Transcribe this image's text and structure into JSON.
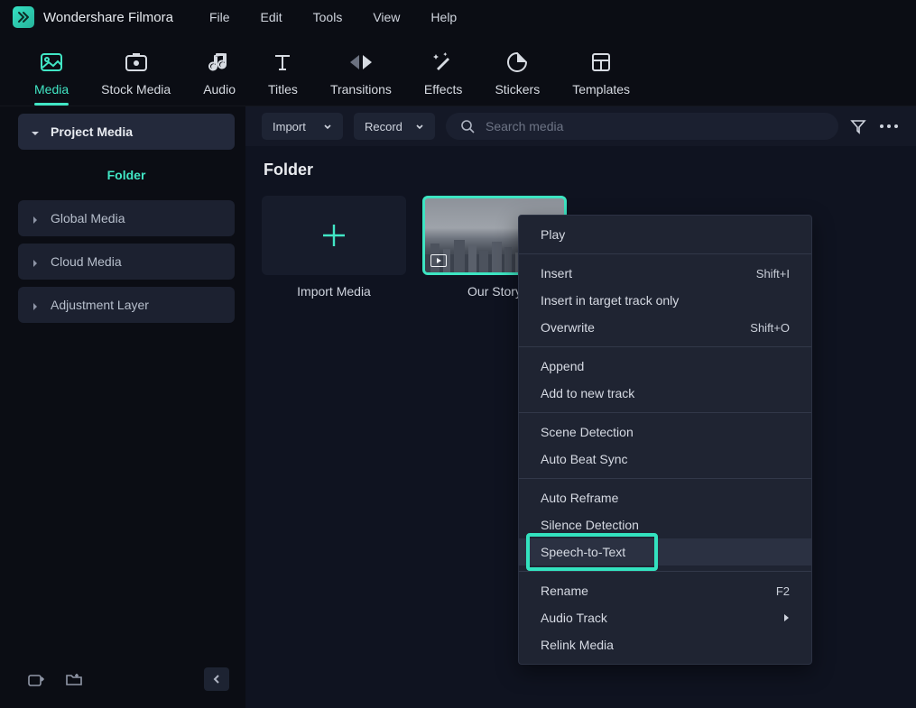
{
  "app": {
    "title": "Wondershare Filmora"
  },
  "menubar": [
    "File",
    "Edit",
    "Tools",
    "View",
    "Help"
  ],
  "tabs": [
    {
      "label": "Media",
      "icon": "media",
      "active": true
    },
    {
      "label": "Stock Media",
      "icon": "stock"
    },
    {
      "label": "Audio",
      "icon": "audio"
    },
    {
      "label": "Titles",
      "icon": "titles"
    },
    {
      "label": "Transitions",
      "icon": "transitions"
    },
    {
      "label": "Effects",
      "icon": "effects"
    },
    {
      "label": "Stickers",
      "icon": "stickers"
    },
    {
      "label": "Templates",
      "icon": "templates"
    }
  ],
  "sidebar": {
    "project": "Project Media",
    "folder": "Folder",
    "items": [
      "Global Media",
      "Cloud Media",
      "Adjustment Layer"
    ]
  },
  "toolbar": {
    "import": "Import",
    "record": "Record",
    "search_placeholder": "Search media"
  },
  "content": {
    "folder_title": "Folder",
    "import_card": "Import Media",
    "clip_card": "Our Story"
  },
  "context_menu": {
    "groups": [
      [
        {
          "label": "Play"
        }
      ],
      [
        {
          "label": "Insert",
          "shortcut": "Shift+I"
        },
        {
          "label": "Insert in target track only"
        },
        {
          "label": "Overwrite",
          "shortcut": "Shift+O"
        }
      ],
      [
        {
          "label": "Append"
        },
        {
          "label": "Add to new track"
        }
      ],
      [
        {
          "label": "Scene Detection"
        },
        {
          "label": "Auto Beat Sync"
        }
      ],
      [
        {
          "label": "Auto Reframe"
        },
        {
          "label": "Silence Detection"
        },
        {
          "label": "Speech-to-Text",
          "highlighted": true,
          "hover": true
        }
      ],
      [
        {
          "label": "Rename",
          "shortcut": "F2"
        },
        {
          "label": "Audio Track",
          "submenu": true
        },
        {
          "label": "Relink Media"
        }
      ]
    ]
  }
}
